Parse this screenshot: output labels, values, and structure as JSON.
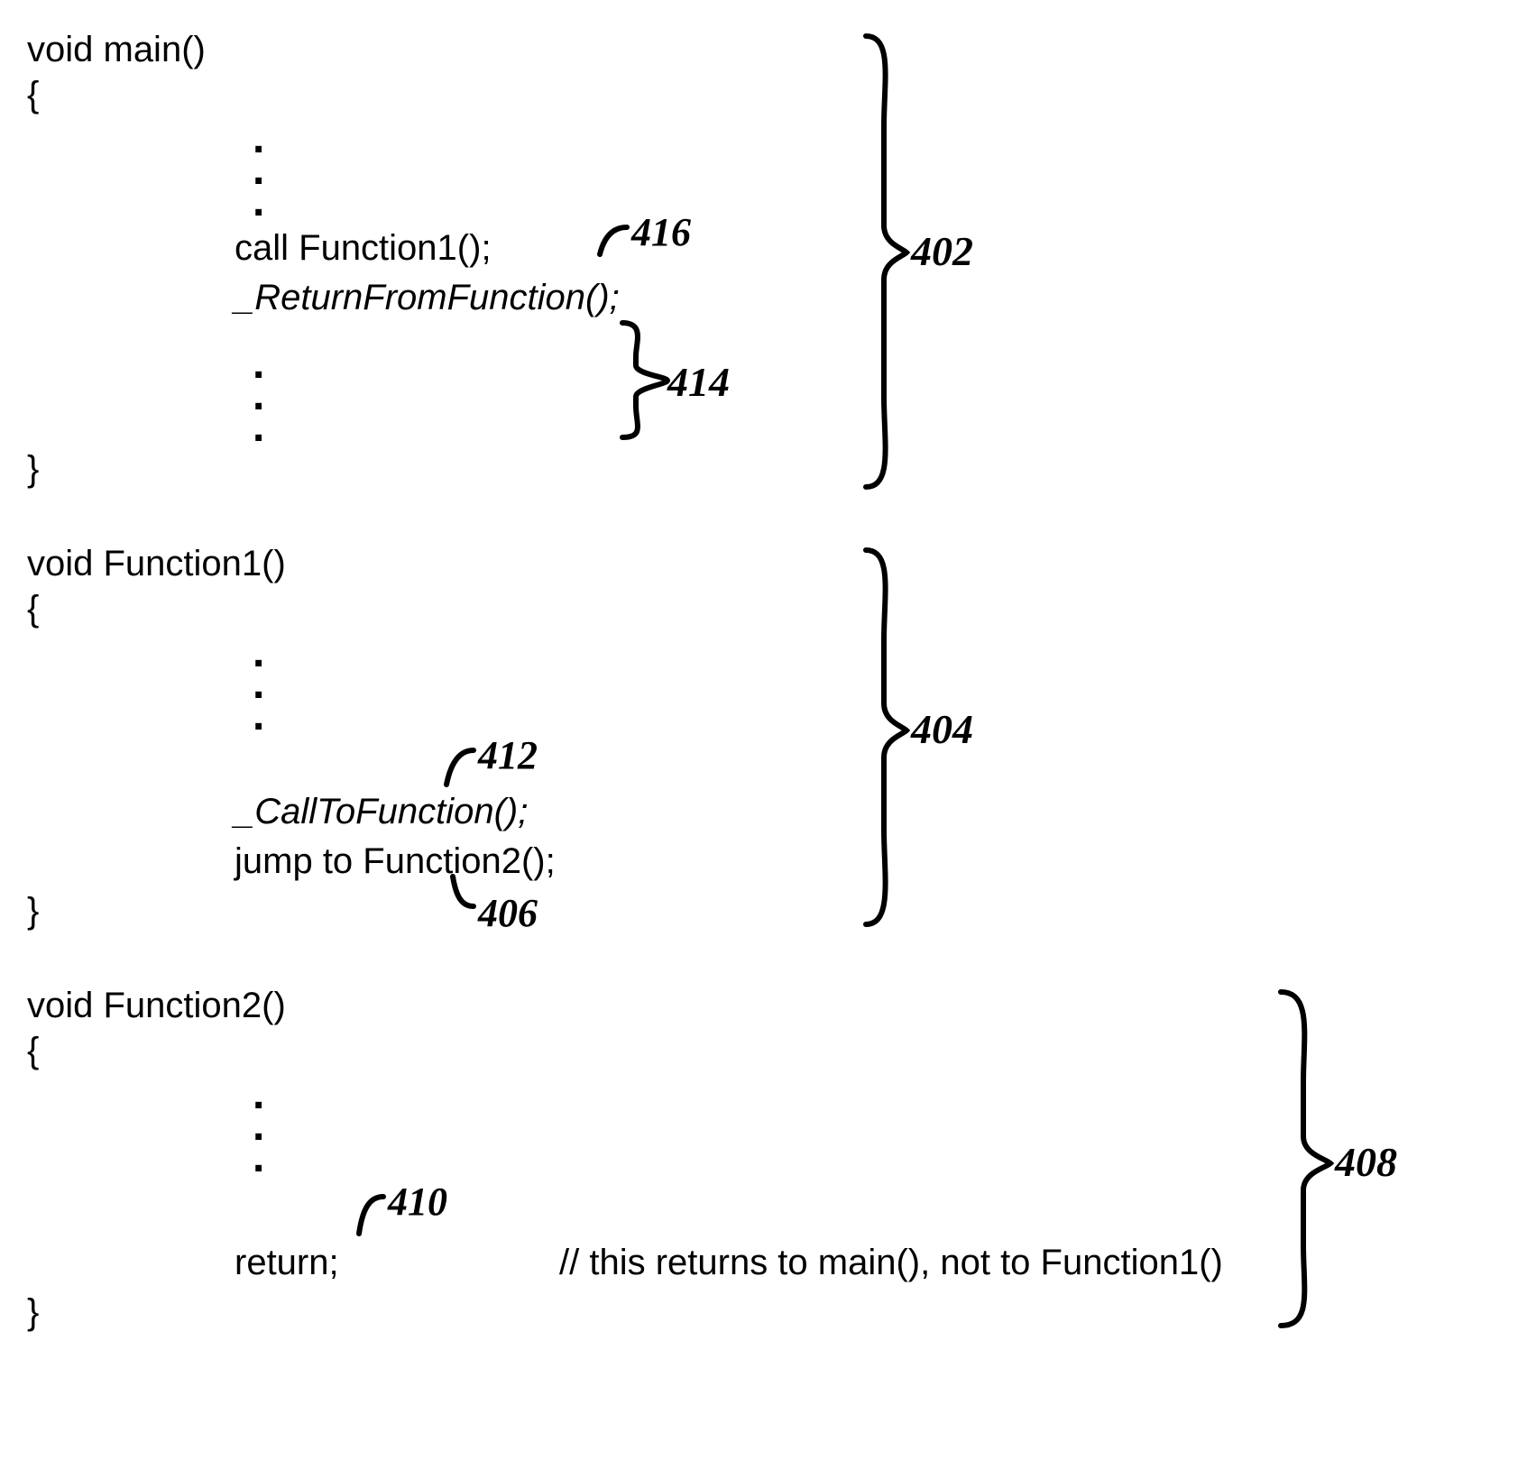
{
  "block1": {
    "sig": "void main()",
    "open": "{",
    "close": "}",
    "line1": "call Function1();",
    "line2": "_ReturnFromFunction();",
    "brace_label": "402",
    "inner_brace_label": "414",
    "callout_label": "416"
  },
  "block2": {
    "sig": "void Function1()",
    "open": "{",
    "close": "}",
    "line1": "_CallToFunction();",
    "line2": "jump to Function2();",
    "brace_label": "404",
    "callout_label_top": "412",
    "callout_label_bottom": "406"
  },
  "block3": {
    "sig": "void Function2()",
    "open": "{",
    "close": "}",
    "line1": "return;",
    "comment": "// this returns to main(), not to Function1()",
    "brace_label": "408",
    "callout_label": "410"
  }
}
